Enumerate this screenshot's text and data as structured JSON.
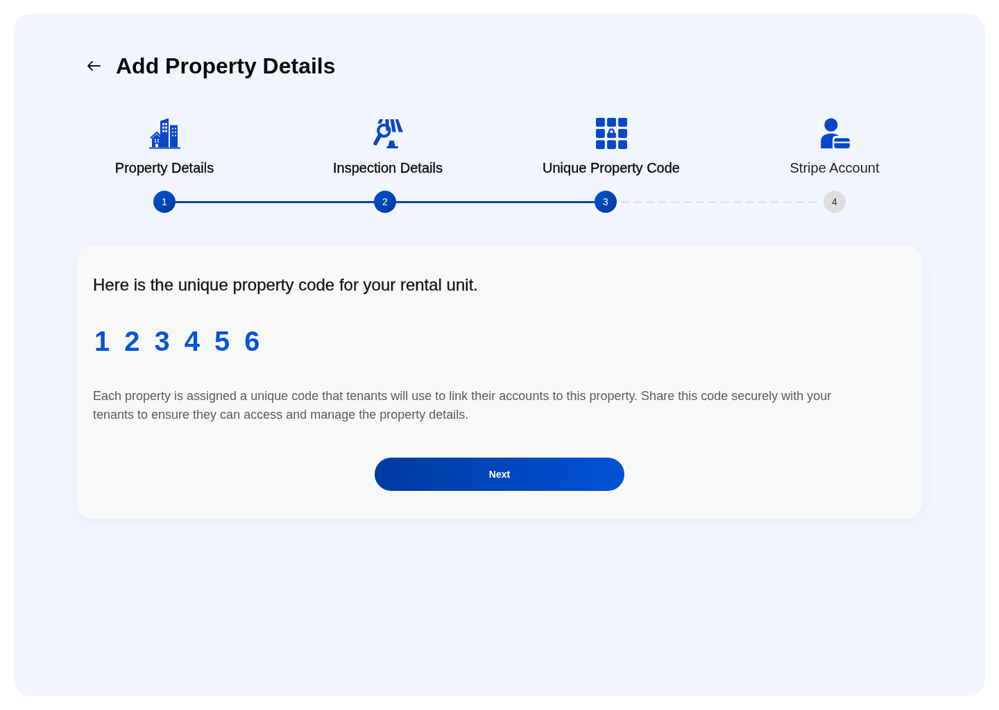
{
  "header": {
    "title": "Add Property Details"
  },
  "steps": [
    {
      "label": "Property Details",
      "number": "1",
      "completed": true
    },
    {
      "label": "Inspection Details",
      "number": "2",
      "completed": true
    },
    {
      "label": "Unique Property Code",
      "number": "3",
      "completed": true
    },
    {
      "label": "Stripe Account",
      "number": "4",
      "completed": false
    }
  ],
  "card": {
    "heading": "Here is the unique property code for your rental unit.",
    "code_digits": [
      "1",
      "2",
      "3",
      "4",
      "5",
      "6"
    ],
    "description": "Each property is assigned a unique code that tenants will use to link their accounts to this property. Share this code securely with your tenants to ensure they can access and manage the property details.",
    "button_label": "Next"
  }
}
